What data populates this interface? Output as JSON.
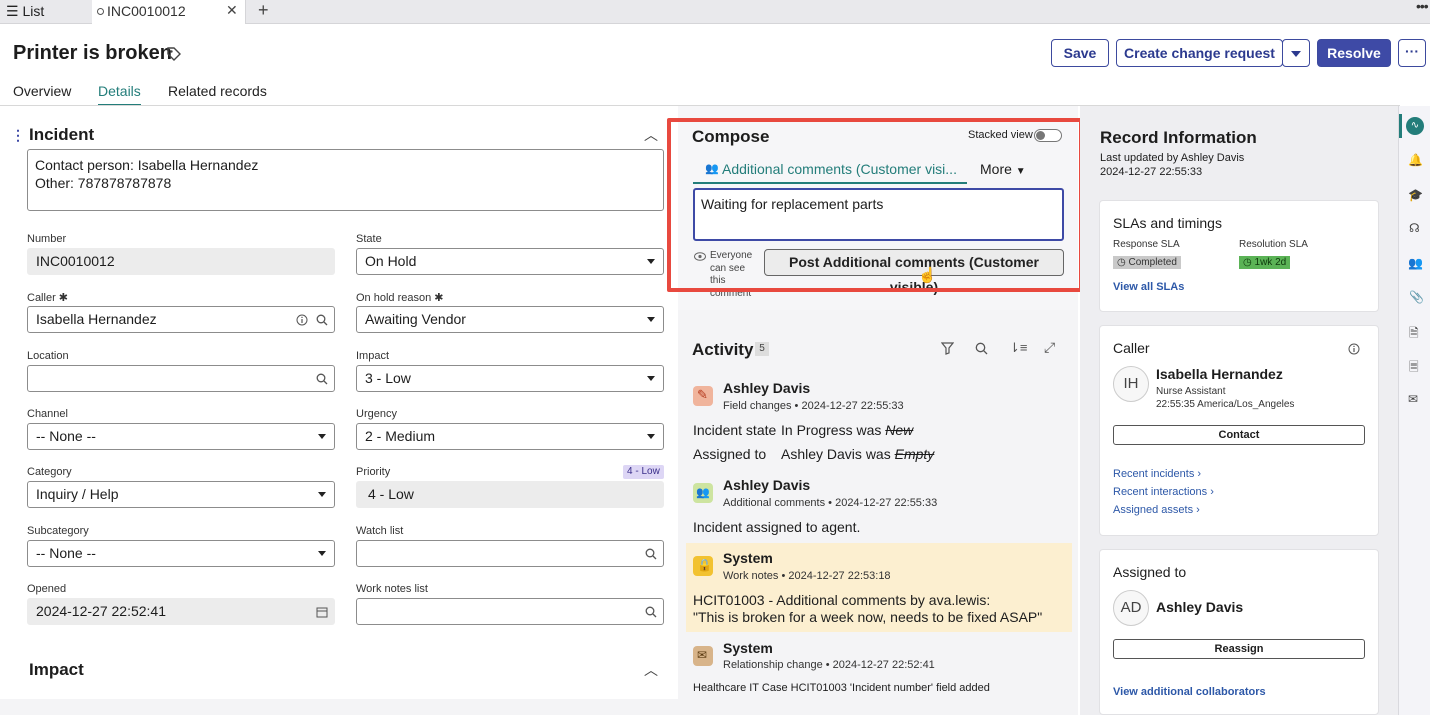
{
  "tabs": {
    "list_label": "List",
    "active_label": "INC0010012"
  },
  "header": {
    "title": "Printer is broken",
    "save": "Save",
    "create_change": "Create change request",
    "resolve": "Resolve"
  },
  "nav_tabs": [
    "Overview",
    "Details",
    "Related records"
  ],
  "incident": {
    "section_title": "Incident",
    "description_lines": [
      "Contact person: Isabella Hernandez",
      "Other: 787878787878"
    ],
    "labels": {
      "number": "Number",
      "state": "State",
      "caller": "Caller",
      "on_hold_reason": "On hold reason",
      "location": "Location",
      "impact": "Impact",
      "channel": "Channel",
      "urgency": "Urgency",
      "category": "Category",
      "priority": "Priority",
      "subcategory": "Subcategory",
      "watch_list": "Watch list",
      "opened": "Opened",
      "work_notes_list": "Work notes list"
    },
    "values": {
      "number": "INC0010012",
      "state": "On Hold",
      "caller": "Isabella Hernandez",
      "on_hold_reason": "Awaiting Vendor",
      "location": "",
      "impact": "3 - Low",
      "channel": "-- None --",
      "urgency": "2 - Medium",
      "category": "Inquiry / Help",
      "priority": "4 - Low",
      "priority_badge": "4 - Low",
      "subcategory": "-- None --",
      "watch_list": "",
      "opened": "2024-12-27 22:52:41",
      "work_notes_list": ""
    },
    "impact_section_title": "Impact"
  },
  "compose": {
    "title": "Compose",
    "stacked_view": "Stacked view",
    "tab_label": "Additional comments (Customer visi...",
    "more": "More",
    "text": "Waiting for replacement parts",
    "visibility_note": [
      "Everyone",
      "can see",
      "this",
      "comment"
    ],
    "post_button": "Post Additional comments (Customer visible)"
  },
  "activity": {
    "title": "Activity",
    "count": "5",
    "entries": [
      {
        "name": "Ashley Davis",
        "type": "Field changes",
        "time": "2024-12-27 22:55:33",
        "changes": [
          {
            "field": "Incident state",
            "new": "In Progress",
            "was": "was",
            "old": "New"
          },
          {
            "field": "Assigned to",
            "new": "Ashley Davis",
            "was": "was",
            "old": "Empty"
          }
        ]
      },
      {
        "name": "Ashley Davis",
        "type": "Additional comments",
        "time": "2024-12-27 22:55:33",
        "text": "Incident assigned to agent."
      },
      {
        "name": "System",
        "type": "Work notes",
        "time": "2024-12-27 22:53:18",
        "lines": [
          "HCIT01003 - Additional comments by ava.lewis:",
          "\"This is broken for a week now, needs to be fixed ASAP\""
        ]
      },
      {
        "name": "System",
        "type": "Relationship change",
        "time": "2024-12-27 22:52:41",
        "text": "Healthcare IT Case HCIT01003 'Incident number' field added"
      }
    ]
  },
  "record_info": {
    "title": "Record Information",
    "updated_by": "Last updated by Ashley Davis",
    "updated_at": "2024-12-27 22:55:33"
  },
  "slas": {
    "title": "SLAs and timings",
    "response_label": "Response SLA",
    "response_value": "Completed",
    "resolution_label": "Resolution SLA",
    "resolution_value": "1wk 2d",
    "view_all": "View all SLAs"
  },
  "caller_card": {
    "title": "Caller",
    "initials": "IH",
    "name": "Isabella Hernandez",
    "role": "Nurse Assistant",
    "time": "22:55:35 America/Los_Angeles",
    "contact": "Contact",
    "links": [
      "Recent incidents",
      "Recent interactions",
      "Assigned assets"
    ]
  },
  "assigned_card": {
    "title": "Assigned to",
    "initials": "AD",
    "name": "Ashley Davis",
    "reassign": "Reassign",
    "collab_link": "View additional collaborators"
  },
  "colors": {
    "accent": "#237d7a",
    "primary": "#3e4aa6",
    "highlight": "#fcefd0",
    "redbox": "#e8493f",
    "sla_ok": "#5bb356"
  }
}
